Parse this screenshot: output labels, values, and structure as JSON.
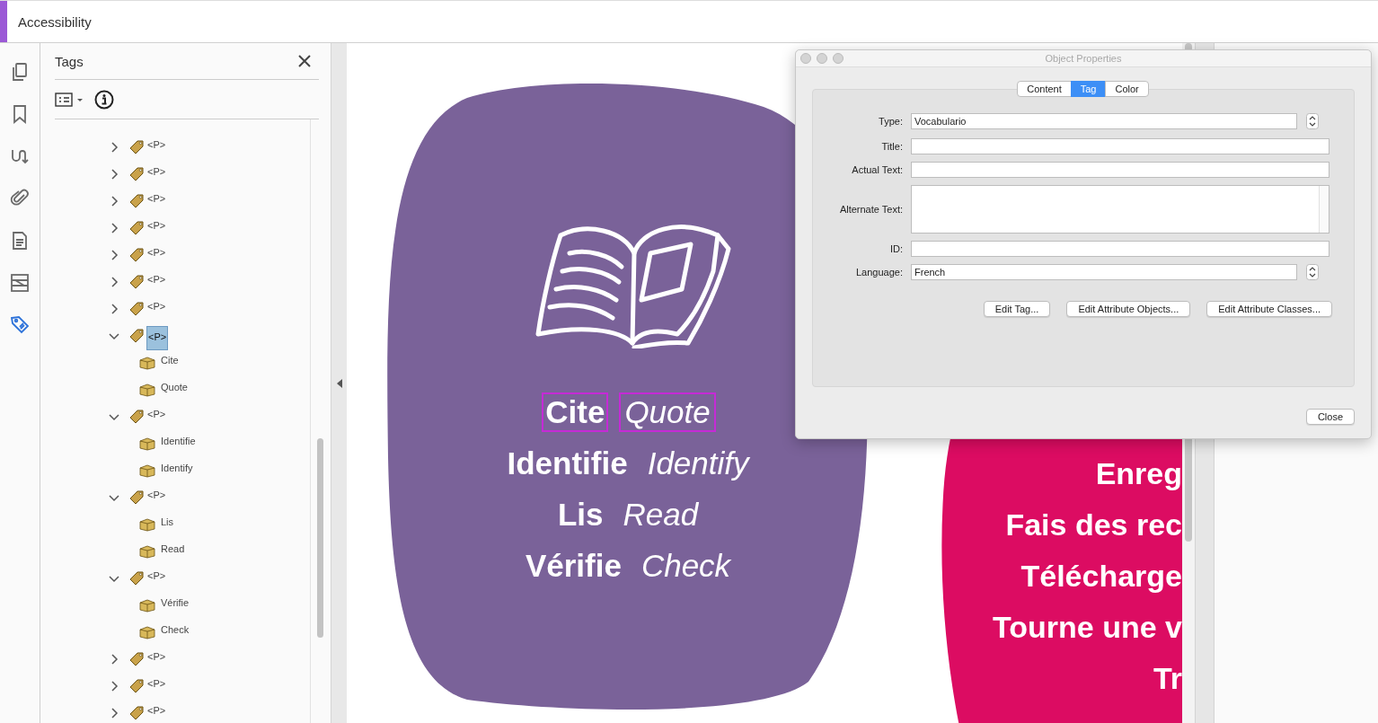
{
  "app": {
    "title": "Accessibility"
  },
  "rail": [
    {
      "kind": "pages",
      "selected": false
    },
    {
      "kind": "bookmark",
      "selected": false
    },
    {
      "kind": "order",
      "selected": false
    },
    {
      "kind": "attachment",
      "selected": false
    },
    {
      "kind": "content",
      "selected": false
    },
    {
      "kind": "fields",
      "selected": false
    },
    {
      "kind": "tags",
      "selected": true
    }
  ],
  "tags_panel": {
    "title": "Tags"
  },
  "tree": [
    {
      "label": "<P>",
      "expanded": false,
      "selected": false
    },
    {
      "label": "<P>",
      "expanded": false,
      "selected": false
    },
    {
      "label": "<P>",
      "expanded": false,
      "selected": false
    },
    {
      "label": "<P>",
      "expanded": false,
      "selected": false
    },
    {
      "label": "<P>",
      "expanded": false,
      "selected": false
    },
    {
      "label": "<P>",
      "expanded": false,
      "selected": false
    },
    {
      "label": "<P>",
      "expanded": false,
      "selected": false
    },
    {
      "label": "<P>",
      "expanded": true,
      "selected": true,
      "children": [
        {
          "label": "Cite",
          "selected": false
        },
        {
          "label": "Quote",
          "selected": false
        }
      ]
    },
    {
      "label": "<P>",
      "expanded": true,
      "selected": false,
      "children": [
        {
          "label": "Identifie",
          "selected": false
        },
        {
          "label": "Identify",
          "selected": false
        }
      ]
    },
    {
      "label": "<P>",
      "expanded": true,
      "selected": false,
      "children": [
        {
          "label": "Lis",
          "selected": false
        },
        {
          "label": "Read",
          "selected": false
        }
      ]
    },
    {
      "label": "<P>",
      "expanded": true,
      "selected": false,
      "children": [
        {
          "label": "Vérifie",
          "selected": false
        },
        {
          "label": "Check",
          "selected": false
        }
      ]
    },
    {
      "label": "<P>",
      "expanded": false,
      "selected": false
    },
    {
      "label": "<P>",
      "expanded": false,
      "selected": false
    },
    {
      "label": "<P>",
      "expanded": false,
      "selected": false
    }
  ],
  "document": {
    "lines": [
      {
        "term": "Cite",
        "translation": "Quote",
        "highlighted": true
      },
      {
        "term": "Identifie",
        "translation": "Identify",
        "highlighted": false
      },
      {
        "term": "Lis",
        "translation": "Read",
        "highlighted": false
      },
      {
        "term": "Vérifie",
        "translation": "Check",
        "highlighted": false
      }
    ],
    "pink_lines": [
      "Enreg",
      "Fais des rec",
      "Télécharge",
      "Tourne une v",
      "Tr"
    ]
  },
  "dialog": {
    "title": "Object Properties",
    "tabs": [
      {
        "label": "Content",
        "selected": false
      },
      {
        "label": "Tag",
        "selected": true
      },
      {
        "label": "Color",
        "selected": false
      }
    ],
    "fields": [
      {
        "label": "Type:",
        "kind": "select",
        "value": "Vocabulario"
      },
      {
        "label": "Title:",
        "kind": "text"
      },
      {
        "label": "Actual Text:",
        "kind": "text"
      },
      {
        "label": "Alternate Text:",
        "kind": "area"
      },
      {
        "label": "ID:",
        "kind": "text"
      },
      {
        "label": "Language:",
        "kind": "select",
        "value": "French"
      }
    ],
    "buttons": [
      "Edit Tag...",
      "Edit Attribute Objects...",
      "Edit Attribute Classes..."
    ],
    "close": "Close"
  }
}
